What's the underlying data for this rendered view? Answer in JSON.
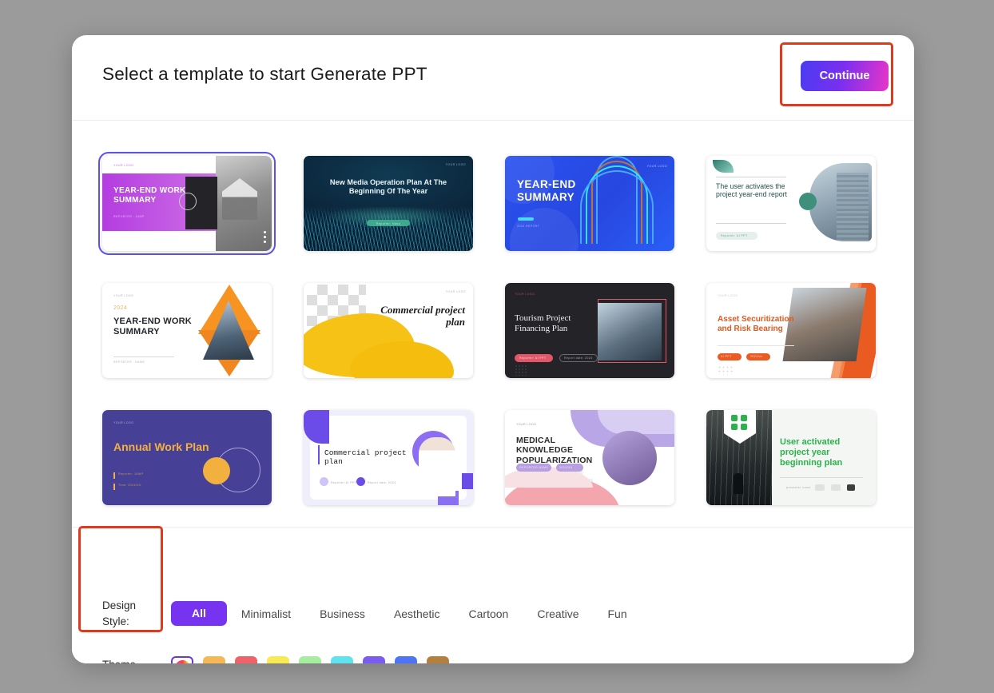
{
  "header": {
    "title": "Select a template to start Generate PPT",
    "continue_label": "Continue"
  },
  "templates": [
    {
      "id": "t1",
      "title": "YEAR-END WORK SUMMARY",
      "logo": "YOUR LOGO",
      "subtitle": "REPORTER : JUMP",
      "selected": true
    },
    {
      "id": "t2",
      "title": "New Media Operation Plan At The Beginning Of The Year",
      "logo": "YOUR LOGO",
      "subtitle": "Reporter: Nana",
      "selected": false
    },
    {
      "id": "t3",
      "title": "YEAR-END SUMMARY",
      "logo": "YOUR LOGO",
      "subtitle": "2024 REPORT",
      "selected": false
    },
    {
      "id": "t4",
      "title": "The user activates the project year-end report",
      "logo": "YOUR LOGO",
      "subtitle": "Reporter: AI PPT",
      "selected": false
    },
    {
      "id": "t5",
      "title": "YEAR-END WORK SUMMARY",
      "logo": "YOUR LOGO",
      "subtitle": "REPORTER : NAME",
      "year": "2024",
      "selected": false
    },
    {
      "id": "t6",
      "title": "Commercial project plan",
      "logo": "YOUR LOGO",
      "subtitle": "",
      "selected": false
    },
    {
      "id": "t7",
      "title": "Tourism Project Financing Plan",
      "logo": "YOUR LOGO",
      "subtitle": "Reporter: AI PPT",
      "extra": "Report date: 2024",
      "selected": false
    },
    {
      "id": "t8",
      "title": "Asset Securitization and Risk Bearing",
      "logo": "YOUR LOGO",
      "subtitle": "AI PPT",
      "extra": "2024/xx",
      "selected": false
    },
    {
      "id": "t9",
      "title": "Annual Work Plan",
      "logo": "YOUR LOGO",
      "subtitle": "Reporter: JUMP",
      "extra": "Time: 2024/XX",
      "selected": false
    },
    {
      "id": "t10",
      "title": "Commercial project plan",
      "logo": "",
      "subtitle": "Reporter:AI PPT",
      "extra": "Report date: 2024",
      "selected": false
    },
    {
      "id": "t11",
      "title": "MEDICAL KNOWLEDGE POPULARIZATION",
      "logo": "YOUR LOGO",
      "subtitle": "REPORTER NAME",
      "extra": "2024/XX",
      "selected": false
    },
    {
      "id": "t12",
      "title": "User activated project year beginning plan",
      "logo": "",
      "subtitle": "presenter name",
      "selected": false
    }
  ],
  "filters": {
    "design_style_label": "Design Style:",
    "theme_color_label": "Theme Color:",
    "tabs": [
      {
        "label": "All",
        "active": true
      },
      {
        "label": "Minimalist",
        "active": false
      },
      {
        "label": "Business",
        "active": false
      },
      {
        "label": "Aesthetic",
        "active": false
      },
      {
        "label": "Cartoon",
        "active": false
      },
      {
        "label": "Creative",
        "active": false
      },
      {
        "label": "Fun",
        "active": false
      }
    ],
    "swatches": [
      {
        "name": "color-wheel",
        "color": "rainbow",
        "selected": true
      },
      {
        "name": "orange",
        "color": "#f6b756",
        "selected": false
      },
      {
        "name": "red",
        "color": "#f0626a",
        "selected": false
      },
      {
        "name": "yellow",
        "color": "#f7ea52",
        "selected": false
      },
      {
        "name": "green",
        "color": "#a6eda0",
        "selected": false
      },
      {
        "name": "cyan",
        "color": "#5fe3ef",
        "selected": false
      },
      {
        "name": "purple",
        "color": "#7a5cf0",
        "selected": false
      },
      {
        "name": "blue",
        "color": "#4d74f5",
        "selected": false
      },
      {
        "name": "brown",
        "color": "#b5803f",
        "selected": false
      }
    ]
  },
  "colors": {
    "accent": "#7633f0",
    "annotation": "#e03a1e",
    "backdrop": "#9b9b9b"
  }
}
